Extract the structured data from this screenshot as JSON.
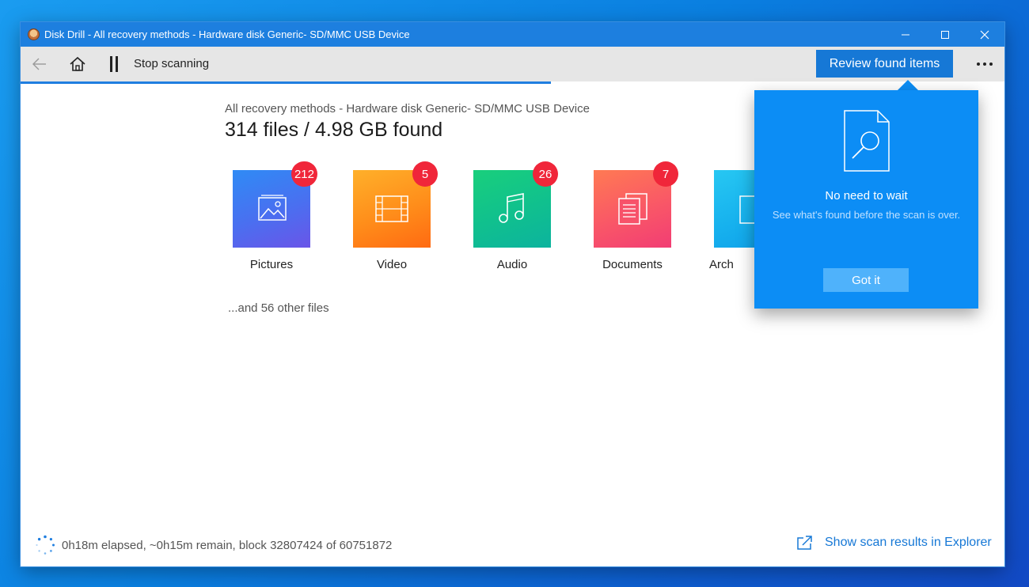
{
  "window": {
    "title": "Disk Drill - All recovery methods - Hardware disk Generic- SD/MMC USB Device",
    "controls": [
      "minimize-icon",
      "maximize-icon",
      "close-icon"
    ]
  },
  "toolbar": {
    "back_icon": "arrow-left-icon",
    "home_icon": "home-icon",
    "pause_icon": "pause-icon",
    "stop_label": "Stop scanning",
    "review_label": "Review found items",
    "more_icon": "more-dots-icon"
  },
  "main": {
    "subtitle": "All recovery methods - Hardware disk Generic- SD/MMC USB Device",
    "headline": "314 files / 4.98 GB found",
    "categories": [
      {
        "label": "Pictures",
        "count": "212",
        "icon": "picture-icon"
      },
      {
        "label": "Video",
        "count": "5",
        "icon": "film-icon"
      },
      {
        "label": "Audio",
        "count": "26",
        "icon": "music-note-icon"
      },
      {
        "label": "Documents",
        "count": "7",
        "icon": "document-icon"
      },
      {
        "label": "Arch",
        "icon": "archive-icon"
      }
    ],
    "other_files": "...and 56 other files"
  },
  "footer": {
    "status": "0h18m elapsed, ~0h15m remain, block 32807424 of 60751872",
    "explorer_link": "Show scan results in Explorer"
  },
  "popup": {
    "icon": "search-document-icon",
    "title": "No need to wait",
    "description": "See what's found before the scan is over.",
    "button": "Got it"
  },
  "colors": {
    "accent": "#1678d6",
    "titlebar": "#1d7fdf",
    "popup": "#0c8df5",
    "badge": "#f0263a"
  }
}
